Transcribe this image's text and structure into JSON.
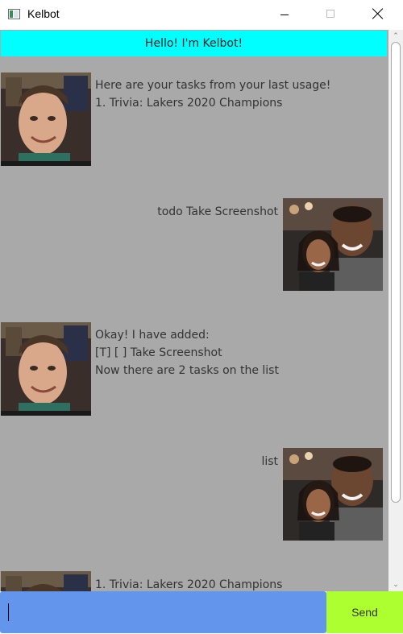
{
  "window": {
    "title": "Kelbot"
  },
  "banner": {
    "text": "Hello! I'm Kelbot!"
  },
  "dialog": [
    {
      "speaker": "bot",
      "lines": [
        "Here are your tasks from your last usage!",
        "1. Trivia:  Lakers 2020 Champions"
      ]
    },
    {
      "speaker": "user",
      "lines": [
        "todo Take Screenshot"
      ]
    },
    {
      "speaker": "bot",
      "lines": [
        "Okay! I have added:",
        "[T] [ ] Take Screenshot",
        "Now there are 2 tasks on the list"
      ]
    },
    {
      "speaker": "user",
      "lines": [
        "list"
      ]
    },
    {
      "speaker": "bot",
      "lines": [
        "1. Trivia:  Lakers 2020 Champions"
      ]
    }
  ],
  "input": {
    "value": ""
  },
  "send": {
    "label": "Send"
  },
  "colors": {
    "banner": "#00ffff",
    "chat_bg": "#a9a9a9",
    "input_bg": "#6495ed",
    "send_bg": "#adff2f"
  },
  "icons": {
    "app": "window-app-icon",
    "minimize": "minimize-icon",
    "maximize": "maximize-icon",
    "close": "close-icon"
  }
}
